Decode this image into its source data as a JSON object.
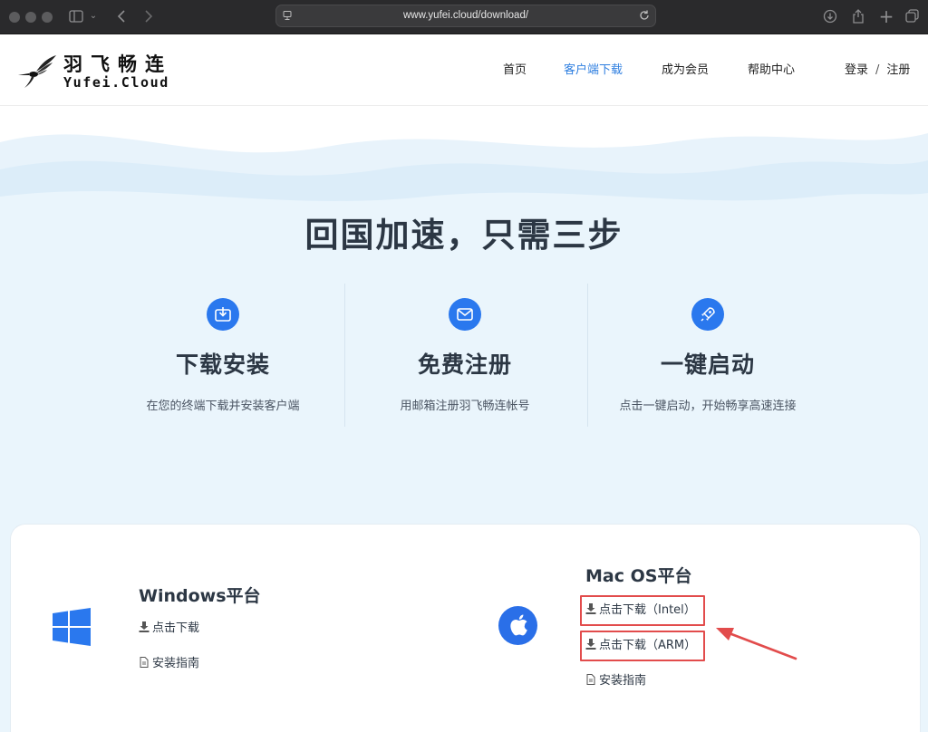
{
  "browser": {
    "url": "www.yufei.cloud/download/"
  },
  "header": {
    "logo_cn": "羽飞畅连",
    "logo_en": "Yufei.Cloud",
    "nav": [
      {
        "label": "首页"
      },
      {
        "label": "客户端下载"
      },
      {
        "label": "成为会员"
      },
      {
        "label": "帮助中心"
      }
    ],
    "auth": {
      "login": "登录",
      "separator": "/",
      "register": "注册"
    }
  },
  "hero": {
    "title": "回国加速，只需三步",
    "steps": [
      {
        "icon": "download-box-icon",
        "title": "下载安装",
        "desc": "在您的终端下载并安装客户端"
      },
      {
        "icon": "mail-icon",
        "title": "免费注册",
        "desc": "用邮箱注册羽飞畅连帐号"
      },
      {
        "icon": "rocket-icon",
        "title": "一键启动",
        "desc": "点击一键启动，开始畅享高速连接"
      }
    ]
  },
  "downloads": {
    "windows": {
      "title": "Windows平台",
      "download_label": "点击下载",
      "guide_label": "安装指南"
    },
    "mac": {
      "title": "Mac OS平台",
      "intel_label": "点击下载（Intel）",
      "arm_label": "点击下载（ARM）",
      "guide_label": "安装指南"
    }
  },
  "colors": {
    "accent": "#2a78ee",
    "nav_active": "#2f7fe0",
    "hero_bg": "#eaf5fc",
    "annotation": "#e24c4c"
  }
}
